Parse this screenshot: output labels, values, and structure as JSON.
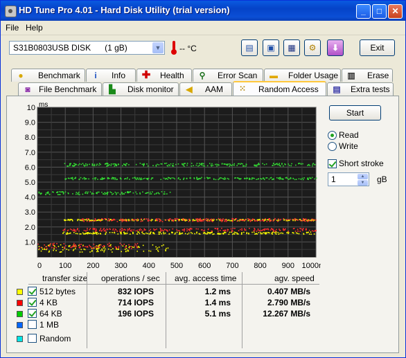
{
  "window": {
    "title": "HD Tune Pro 4.01 - Hard Disk Utility (trial version)",
    "minimize_glyph": "_",
    "maximize_glyph": "□",
    "close_glyph": "✕"
  },
  "menu": {
    "items": [
      "File",
      "Help"
    ]
  },
  "toolbar": {
    "drive": "S31B0803USB DISK      (1 gB)",
    "temperature": "-- °C",
    "exit_label": "Exit",
    "buttons": [
      "copy-text-icon",
      "copy-screenshot-icon",
      "save-icon",
      "options-icon",
      "download-icon"
    ]
  },
  "tabs_row1": [
    "Benchmark",
    "Info",
    "Health",
    "Error Scan",
    "Folder Usage",
    "Erase"
  ],
  "tabs_row2": [
    "File Benchmark",
    "Disk monitor",
    "AAM",
    "Random Access",
    "Extra tests"
  ],
  "active_tab": "Random Access",
  "side": {
    "start_label": "Start",
    "read_label": "Read",
    "write_label": "Write",
    "read_selected": true,
    "short_stroke_label": "Short stroke",
    "short_stroke_checked": true,
    "stroke_value": "1",
    "stroke_unit": "gB"
  },
  "table": {
    "headers": [
      "transfer size",
      "operations / sec",
      "avg. access time",
      "agv. speed"
    ],
    "rows": [
      {
        "color": "#ffff00",
        "checked": true,
        "size": "512 bytes",
        "ops": "832 IOPS",
        "access": "1.2 ms",
        "speed": "0.407 MB/s"
      },
      {
        "color": "#ff0000",
        "checked": true,
        "size": "4 KB",
        "ops": "714 IOPS",
        "access": "1.4 ms",
        "speed": "2.790 MB/s"
      },
      {
        "color": "#00cc00",
        "checked": true,
        "size": "64 KB",
        "ops": "196 IOPS",
        "access": "5.1 ms",
        "speed": "12.267 MB/s"
      },
      {
        "color": "#0066ff",
        "checked": false,
        "size": "1 MB",
        "ops": "",
        "access": "",
        "speed": ""
      },
      {
        "color": "#00e5e5",
        "checked": false,
        "size": "Random",
        "ops": "",
        "access": "",
        "speed": ""
      }
    ]
  },
  "chart_data": {
    "type": "scatter",
    "ylabel": "ms",
    "ylim": [
      0,
      10
    ],
    "xlim": [
      0,
      1000
    ],
    "yticks": [
      "10",
      "9.0",
      "8.0",
      "7.0",
      "6.0",
      "5.0",
      "4.0",
      "3.0",
      "2.0",
      "1.0"
    ],
    "xticks": [
      "0",
      "100",
      "200",
      "300",
      "400",
      "500",
      "600",
      "700",
      "800",
      "900",
      "1000mB"
    ],
    "grid": true,
    "series": [
      {
        "color": "#ffff00",
        "bands": [
          {
            "x": [
              0,
              480
            ],
            "y": [
              0.35,
              0.85
            ]
          },
          {
            "x": [
              90,
              1000
            ],
            "y": [
              1.55,
              1.7
            ]
          },
          {
            "x": [
              90,
              1000
            ],
            "y": [
              2.45,
              2.55
            ]
          }
        ]
      },
      {
        "color": "#ff3030",
        "bands": [
          {
            "x": [
              0,
              360
            ],
            "y": [
              0.6,
              0.95
            ]
          },
          {
            "x": [
              90,
              1000
            ],
            "y": [
              1.75,
              1.95
            ]
          },
          {
            "x": [
              150,
              1000
            ],
            "y": [
              2.4,
              2.6
            ]
          }
        ]
      },
      {
        "color": "#33dd33",
        "bands": [
          {
            "x": [
              0,
              480
            ],
            "y": [
              4.2,
              4.4
            ]
          },
          {
            "x": [
              90,
              1000
            ],
            "y": [
              5.2,
              5.35
            ]
          },
          {
            "x": [
              90,
              1000
            ],
            "y": [
              6.1,
              6.3
            ]
          }
        ]
      }
    ]
  }
}
